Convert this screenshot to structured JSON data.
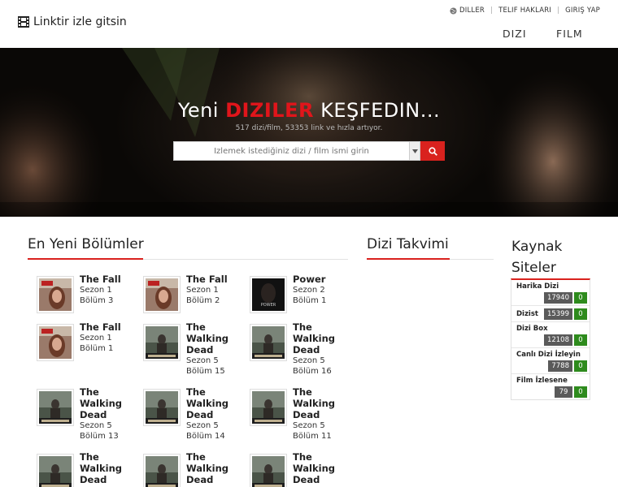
{
  "brand": {
    "name": "Linktir izle gitsin",
    "icon": "film-icon"
  },
  "toplinks": {
    "languages": "DILLER",
    "copyright": "TELIF HAKLARI",
    "login": "GIRIŞ YAP"
  },
  "nav": {
    "dizi": "DIZI",
    "film": "FILM"
  },
  "hero": {
    "title_pre": "Yeni",
    "title_accent": "DIZILER",
    "title_post": "KEŞFEDIN...",
    "subtitle": "517 dizi/film, 53353 link ve hızla artıyor.",
    "search_placeholder": "İzlemek istediğiniz dizi / film ismi girin"
  },
  "sections": {
    "latest": "En Yeni Bölümler",
    "calendar": "Dizi Takvimi",
    "sources": "Kaynak Siteler"
  },
  "episodes": [
    {
      "title": "The Fall",
      "season": "Sezon 1",
      "episode": "Bölüm 3",
      "poster": "fall"
    },
    {
      "title": "The Fall",
      "season": "Sezon 1",
      "episode": "Bölüm 2",
      "poster": "fall"
    },
    {
      "title": "Power",
      "season": "Sezon 2",
      "episode": "Bölüm 1",
      "poster": "power"
    },
    {
      "title": "The Fall",
      "season": "Sezon 1",
      "episode": "Bölüm 1",
      "poster": "fall"
    },
    {
      "title": "The Walking Dead",
      "season": "Sezon 5",
      "episode": "Bölüm 15",
      "poster": "twd"
    },
    {
      "title": "The Walking Dead",
      "season": "Sezon 5",
      "episode": "Bölüm 16",
      "poster": "twd"
    },
    {
      "title": "The Walking Dead",
      "season": "Sezon 5",
      "episode": "Bölüm 13",
      "poster": "twd"
    },
    {
      "title": "The Walking Dead",
      "season": "Sezon 5",
      "episode": "Bölüm 14",
      "poster": "twd"
    },
    {
      "title": "The Walking Dead",
      "season": "Sezon 5",
      "episode": "Bölüm 11",
      "poster": "twd"
    },
    {
      "title": "The Walking Dead",
      "season": "",
      "episode": "",
      "poster": "twd"
    },
    {
      "title": "The Walking Dead",
      "season": "",
      "episode": "",
      "poster": "twd"
    },
    {
      "title": "The Walking Dead",
      "season": "",
      "episode": "",
      "poster": "twd"
    }
  ],
  "sources": [
    {
      "name": "Harika Dizi",
      "count": "17940",
      "zero": "0"
    },
    {
      "name": "Dizist",
      "count": "15399",
      "zero": "0"
    },
    {
      "name": "Dizi Box",
      "count": "12108",
      "zero": "0"
    },
    {
      "name": "Canlı Dizi İzleyin",
      "count": "7788",
      "zero": "0"
    },
    {
      "name": "Film İzlesene",
      "count": "79",
      "zero": "0"
    }
  ],
  "colors": {
    "accent": "#d9221e",
    "badge_dark": "#5a5a5a",
    "badge_green": "#2e8b1d"
  }
}
